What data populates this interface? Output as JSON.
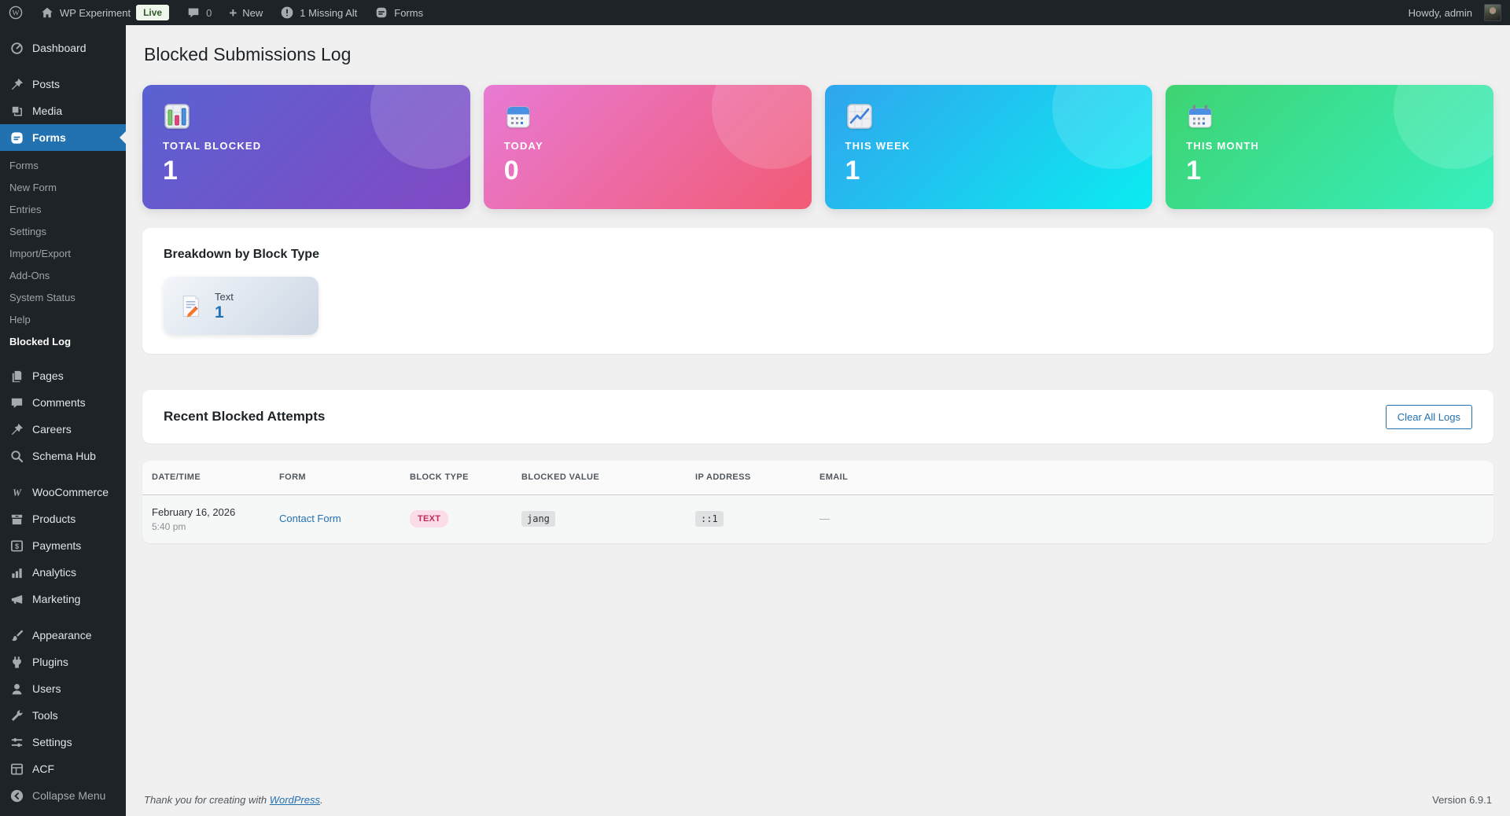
{
  "admin_bar": {
    "site_name": "WP Experiment",
    "live_badge": "Live",
    "comment_count": "0",
    "new_label": "New",
    "missing_alt_label": "1 Missing Alt",
    "forms_label": "Forms",
    "howdy": "Howdy, admin",
    "icons": [
      "wordpress-logo-icon",
      "home-icon",
      "comments-bubble-icon",
      "plus-icon",
      "alert-icon",
      "forms-logo-icon",
      "avatar"
    ]
  },
  "sidebar": {
    "items": [
      {
        "id": "dashboard",
        "label": "Dashboard",
        "icon": "dashboard-icon"
      },
      {
        "id": "posts",
        "label": "Posts",
        "icon": "pushpin-icon"
      },
      {
        "id": "media",
        "label": "Media",
        "icon": "media-icon"
      },
      {
        "id": "forms",
        "label": "Forms",
        "icon": "forms-icon",
        "active": true
      },
      {
        "id": "pages",
        "label": "Pages",
        "icon": "pages-icon"
      },
      {
        "id": "comments",
        "label": "Comments",
        "icon": "comment-icon"
      },
      {
        "id": "careers",
        "label": "Careers",
        "icon": "pushpin-icon"
      },
      {
        "id": "schema-hub",
        "label": "Schema Hub",
        "icon": "search-icon"
      },
      {
        "id": "woocommerce",
        "label": "WooCommerce",
        "icon": "woocommerce-icon"
      },
      {
        "id": "products",
        "label": "Products",
        "icon": "box-icon"
      },
      {
        "id": "payments",
        "label": "Payments",
        "icon": "dollar-icon"
      },
      {
        "id": "analytics",
        "label": "Analytics",
        "icon": "bars-icon"
      },
      {
        "id": "marketing",
        "label": "Marketing",
        "icon": "megaphone-icon"
      },
      {
        "id": "appearance",
        "label": "Appearance",
        "icon": "brush-icon"
      },
      {
        "id": "plugins",
        "label": "Plugins",
        "icon": "plugin-icon"
      },
      {
        "id": "users",
        "label": "Users",
        "icon": "user-icon"
      },
      {
        "id": "tools",
        "label": "Tools",
        "icon": "wrench-icon"
      },
      {
        "id": "settings",
        "label": "Settings",
        "icon": "sliders-icon"
      },
      {
        "id": "acf",
        "label": "ACF",
        "icon": "grid-icon"
      }
    ],
    "forms_submenu": [
      {
        "label": "Forms"
      },
      {
        "label": "New Form"
      },
      {
        "label": "Entries"
      },
      {
        "label": "Settings"
      },
      {
        "label": "Import/Export"
      },
      {
        "label": "Add-Ons"
      },
      {
        "label": "System Status"
      },
      {
        "label": "Help"
      },
      {
        "label": "Blocked Log",
        "current": true
      }
    ],
    "collapse_label": "Collapse Menu"
  },
  "page": {
    "title": "Blocked Submissions Log",
    "stats": [
      {
        "label": "TOTAL BLOCKED",
        "value": "1",
        "icon": "bar-chart-icon",
        "gradient": [
          "#5a62d2",
          "#8249c4"
        ]
      },
      {
        "label": "TODAY",
        "value": "0",
        "icon": "calendar-icon",
        "gradient": [
          "#e87ad4",
          "#f25b74"
        ]
      },
      {
        "label": "THIS WEEK",
        "value": "1",
        "icon": "chart-increasing-icon",
        "gradient": [
          "#30a5ee",
          "#0becf0"
        ]
      },
      {
        "label": "THIS MONTH",
        "value": "1",
        "icon": "spiral-calendar-icon",
        "gradient": [
          "#3ed371",
          "#36f0c0"
        ]
      }
    ],
    "breakdown": {
      "title": "Breakdown by Block Type",
      "items": [
        {
          "label": "Text",
          "value": "1",
          "icon": "memo-icon"
        }
      ]
    },
    "recent": {
      "title": "Recent Blocked Attempts",
      "clear_button_label": "Clear All Logs"
    },
    "table": {
      "headers": [
        "DATE/TIME",
        "FORM",
        "BLOCK TYPE",
        "BLOCKED VALUE",
        "IP ADDRESS",
        "EMAIL"
      ],
      "rows": [
        {
          "date": "February 16, 2026",
          "time": "5:40 pm",
          "form": "Contact Form",
          "block_type": "TEXT",
          "blocked_value": "jang",
          "ip_address": "::1",
          "email": "—"
        }
      ]
    },
    "footer": {
      "thanks_prefix": "Thank you for creating with ",
      "wordpress_link": "WordPress",
      "thanks_suffix": ".",
      "version": "Version 6.9.1"
    }
  },
  "colors": {
    "admin_bar_bg": "#1d2327",
    "active_menu_bg": "#2271b1",
    "link": "#2271b1",
    "live_badge_bg": "#eef6ec",
    "live_badge_text": "#2f5926",
    "badge_text_bg": "#fcdce8",
    "badge_text_color": "#c02a5c",
    "content_bg": "#f0f0f1"
  }
}
